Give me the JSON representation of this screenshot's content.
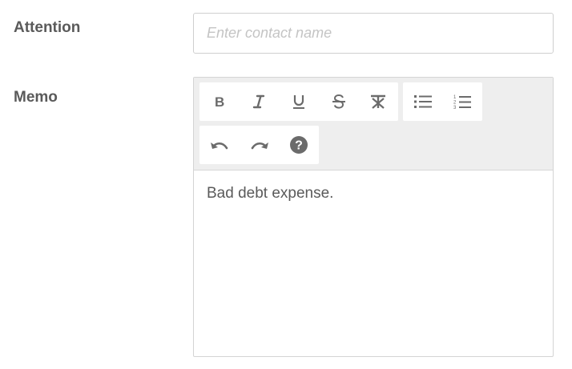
{
  "attention": {
    "label": "Attention",
    "value": "",
    "placeholder": "Enter contact name"
  },
  "memo": {
    "label": "Memo",
    "toolbar": {
      "format_group": [
        "bold-icon",
        "italic-icon",
        "underline-icon",
        "strikethrough-icon",
        "clear-formatting-icon"
      ],
      "list_group": [
        "bullet-list-icon",
        "numbered-list-icon"
      ],
      "history_group": [
        "undo-icon",
        "redo-icon",
        "help-icon"
      ]
    },
    "content": "Bad debt expense."
  },
  "colors": {
    "icon": "#6b6b6b",
    "toolbar_bg": "#eeeeee",
    "border": "#cfcfcf",
    "placeholder": "#c4c4c4"
  }
}
